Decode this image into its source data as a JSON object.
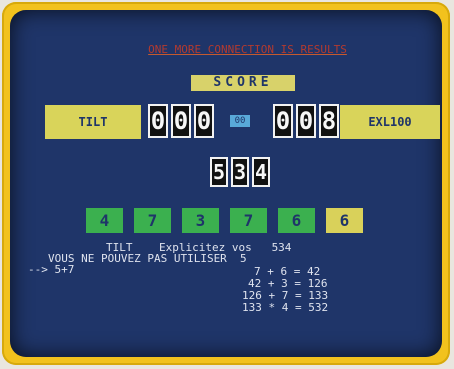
{
  "title": "ONE MORE CONNECTION IS RESULTS",
  "score_label": "SCORE",
  "players": {
    "left": "TILT",
    "right": "EXL100"
  },
  "scores": {
    "left_digits": [
      "0",
      "0",
      "0"
    ],
    "right_digits": [
      "0",
      "0",
      "8"
    ]
  },
  "center_tag": "00",
  "target_digits": [
    "5",
    "3",
    "4"
  ],
  "tiles": [
    "4",
    "7",
    "3",
    "7",
    "6",
    "6"
  ],
  "text_lines": {
    "l1": "TILT    Explicitez vos   534",
    "l2": "VOUS NE POUVEZ PAS UTILISER  5",
    "l3": "--> 5+7",
    "l4": "7 + 6 = 42",
    "l5": "42 + 3 = 126",
    "l6": "126 + 7 = 133",
    "l7": "133 * 4 = 532"
  },
  "colors": {
    "bezel": "#f2c21d",
    "screen": "#1f3569",
    "player_panel": "#d9d45a",
    "tile_green": "#3bb04f",
    "tile_last": "#d9d15a"
  }
}
